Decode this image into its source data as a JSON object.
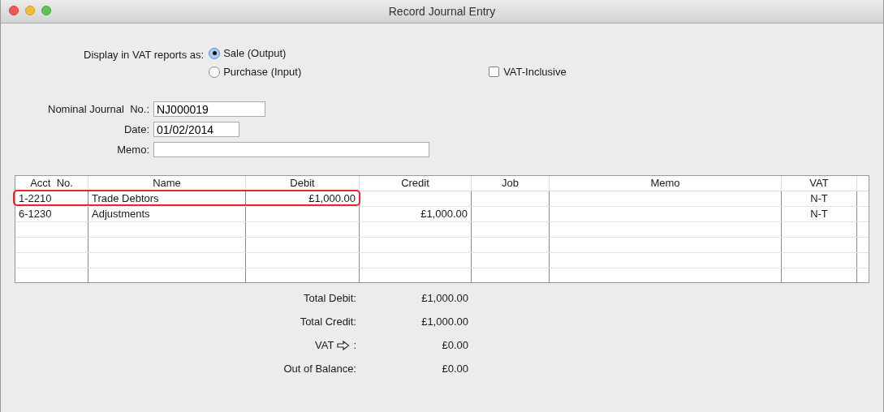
{
  "window": {
    "title": "Record Journal Entry"
  },
  "vat_display": {
    "label": "Display in VAT reports as:",
    "options": [
      {
        "label": "Sale (Output)",
        "selected": true
      },
      {
        "label": "Purchase (Input)",
        "selected": false
      }
    ]
  },
  "vat_inclusive": {
    "label": "VAT-Inclusive",
    "checked": false
  },
  "fields": [
    {
      "label": "Nominal Journal  No.:",
      "value": "NJ000019"
    },
    {
      "label": "Date:",
      "value": "01/02/2014"
    },
    {
      "label": "Memo:"
    }
  ],
  "table": {
    "columns": [
      "Acct  No.",
      "Name",
      "Debit",
      "Credit",
      "Job",
      "Memo",
      "VAT"
    ],
    "rows": [
      {
        "cells": [
          "1-2210",
          "Trade Debtors",
          "£1,000.00",
          "",
          "",
          "",
          "N-T"
        ],
        "highlighted": true
      },
      {
        "cells": [
          "6-1230",
          "Adjustments",
          "",
          "£1,000.00",
          "",
          "",
          "N-T"
        ],
        "highlighted": false
      }
    ]
  },
  "totals": [
    {
      "label": "Total Debit:",
      "value": "£1,000.00",
      "kind": "plain"
    },
    {
      "label": "Total Credit:",
      "value": "£1,000.00",
      "kind": "plain"
    },
    {
      "label": "VAT",
      "suffix": ":",
      "value": "£0.00",
      "kind": "arrow"
    },
    {
      "label": "Out of Balance:",
      "value": "£0.00",
      "kind": "plain"
    }
  ]
}
